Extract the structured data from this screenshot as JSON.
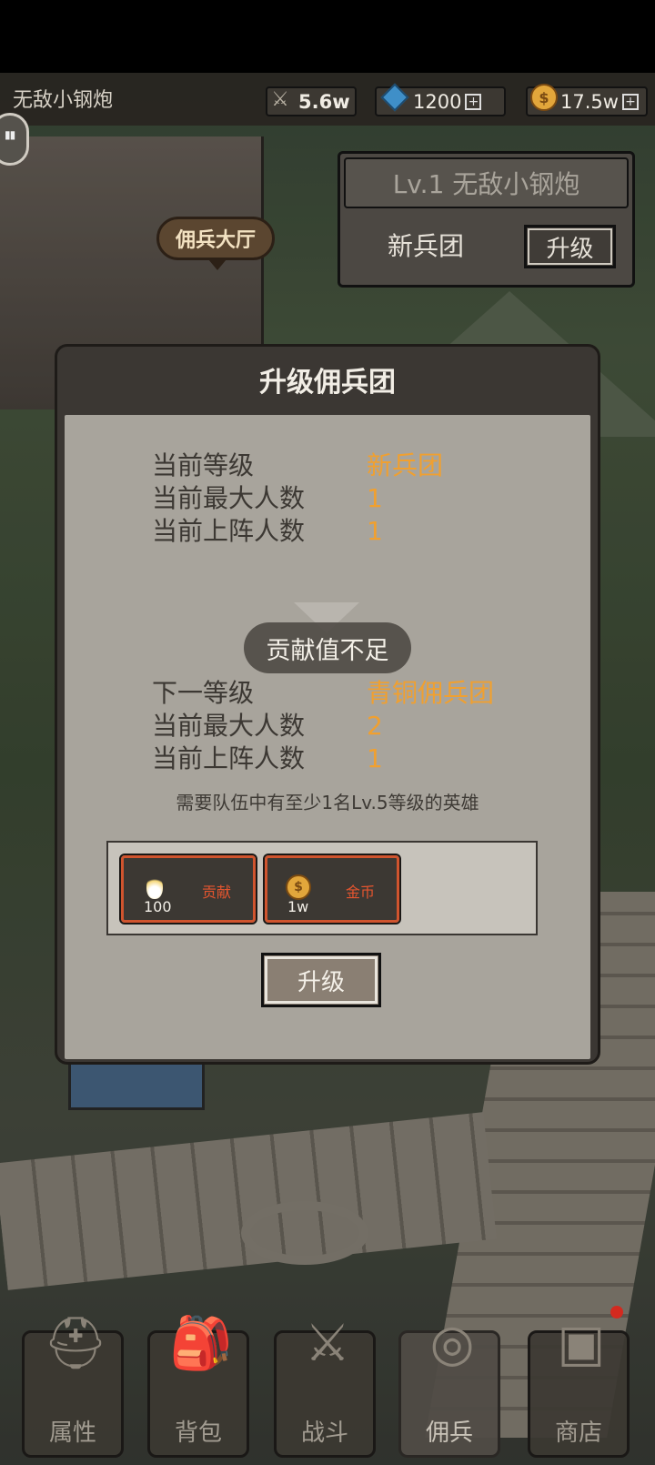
{
  "top_bar": {
    "player_name": "无敌小钢炮",
    "power": "5.6w",
    "gems": "1200",
    "coins": "17.5w",
    "plus": "+"
  },
  "map": {
    "location_tag": "佣兵大厅"
  },
  "guild_panel": {
    "title": "Lv.1 无敌小钢炮",
    "rank": "新兵团",
    "upgrade_label": "升级"
  },
  "modal": {
    "title": "升级佣兵团",
    "current": {
      "rows": [
        {
          "label": "当前等级",
          "value": "新兵团"
        },
        {
          "label": "当前最大人数",
          "value": "1"
        },
        {
          "label": "当前上阵人数",
          "value": "1"
        }
      ]
    },
    "toast": "贡献值不足",
    "next": {
      "rows": [
        {
          "label": "下一等级",
          "value": "青铜佣兵团"
        },
        {
          "label": "当前最大人数",
          "value": "2"
        },
        {
          "label": "当前上阵人数",
          "value": "1"
        }
      ]
    },
    "requirement": "需要队伍中有至少1名Lv.5等级的英雄",
    "costs": [
      {
        "icon": "contribution-icon",
        "amount": "100",
        "name": "贡献"
      },
      {
        "icon": "gold-coin-icon",
        "amount": "1w",
        "name": "金币"
      }
    ],
    "upgrade_label": "升级"
  },
  "bottom_nav": [
    {
      "label": "属性",
      "icon": "helmet-icon"
    },
    {
      "label": "背包",
      "icon": "backpack-icon"
    },
    {
      "label": "战斗",
      "icon": "crossed-swords-icon"
    },
    {
      "label": "佣兵",
      "icon": "target-shield-icon",
      "active": true
    },
    {
      "label": "商店",
      "icon": "chest-icon",
      "badge": true
    }
  ]
}
